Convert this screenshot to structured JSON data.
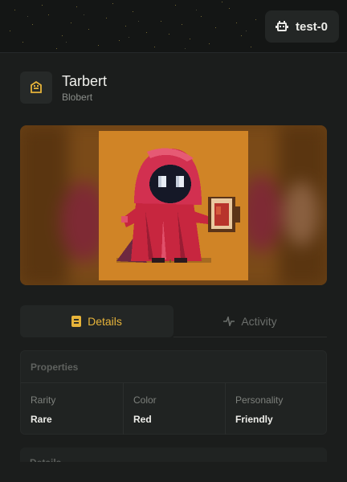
{
  "account": {
    "label": "test-0",
    "icon": "robot-icon"
  },
  "nft": {
    "title": "Tarbert",
    "collection": "Blobert",
    "badge_icon": "blobert-icon",
    "image_alt": "Tarbert"
  },
  "tabs": [
    {
      "label": "Details",
      "icon": "card-icon",
      "active": true
    },
    {
      "label": "Activity",
      "icon": "pulse-icon",
      "active": false
    }
  ],
  "properties": {
    "heading": "Properties",
    "items": [
      {
        "key": "Rarity",
        "value": "Rare"
      },
      {
        "key": "Color",
        "value": "Red"
      },
      {
        "key": "Personality",
        "value": "Friendly"
      }
    ]
  },
  "details_section": {
    "heading": "Details"
  },
  "colors": {
    "accent": "#e7b43a",
    "background": "#1b1d1c",
    "art_bg": "#d08426",
    "robe": "#cc2a47"
  }
}
